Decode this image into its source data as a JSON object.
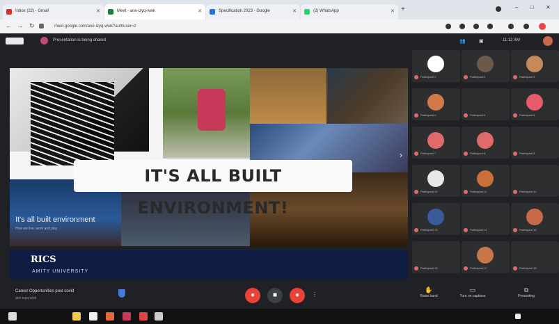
{
  "browser": {
    "tabs": [
      {
        "label": "Inbox (22) - Gmail",
        "color": "#d93025"
      },
      {
        "label": "Meet - ane-izyq-wwk",
        "color": "#188038"
      },
      {
        "label": "Specification 2023 - Google",
        "color": "#1a73e8"
      },
      {
        "label": "(2) WhatsApp",
        "color": "#25d366"
      }
    ],
    "url": "meet.google.com/ane-izyq-wwk?authuser=2",
    "time": "11:12 AM"
  },
  "meet": {
    "presenter_label": "Presentation is being shared",
    "slide": {
      "headline": "IT'S ALL BUILT ENVIRONMENT!",
      "caption": "It's all built environment",
      "subcaption": "How we live, work and play"
    },
    "banner": {
      "logo": "RICS",
      "university": "AMITY UNIVERSITY"
    },
    "meeting_name": "Career Opportunities post covid",
    "meeting_code": "ane-izyq-wwk",
    "right_controls": [
      {
        "label": "Raise hand",
        "icon": "hand-icon"
      },
      {
        "label": "Turn on captions",
        "icon": "captions-icon"
      },
      {
        "label": "Presenting",
        "icon": "present-icon"
      }
    ],
    "participants": [
      {
        "name": "Participant 1",
        "color": "#ffffff"
      },
      {
        "name": "Participant 2",
        "color": "#6b5a4a"
      },
      {
        "name": "Participant 3",
        "color": "#c98a5a"
      },
      {
        "name": "Participant 4",
        "color": "#d07a4a"
      },
      {
        "name": "Participant 5",
        "color": "#2d2e30"
      },
      {
        "name": "Participant 6",
        "color": "#e85a6a"
      },
      {
        "name": "Participant 7",
        "color": "#e06a6a"
      },
      {
        "name": "Participant 8",
        "color": "#e06a6a"
      },
      {
        "name": "Participant 9",
        "color": "#2d2e30"
      },
      {
        "name": "Participant 10",
        "color": "#e8e8e8"
      },
      {
        "name": "Participant 11",
        "color": "#c9703a"
      },
      {
        "name": "Participant 12",
        "color": "#2d2e30"
      },
      {
        "name": "Participant 13",
        "color": "#3a5a9a"
      },
      {
        "name": "Participant 14",
        "color": "#2d2e30"
      },
      {
        "name": "Participant 15",
        "color": "#c96a4a"
      },
      {
        "name": "Participant 16",
        "color": "#2d2e30"
      },
      {
        "name": "Participant 17",
        "color": "#c9764a"
      },
      {
        "name": "Participant 18",
        "color": "#2d2e30"
      }
    ]
  }
}
